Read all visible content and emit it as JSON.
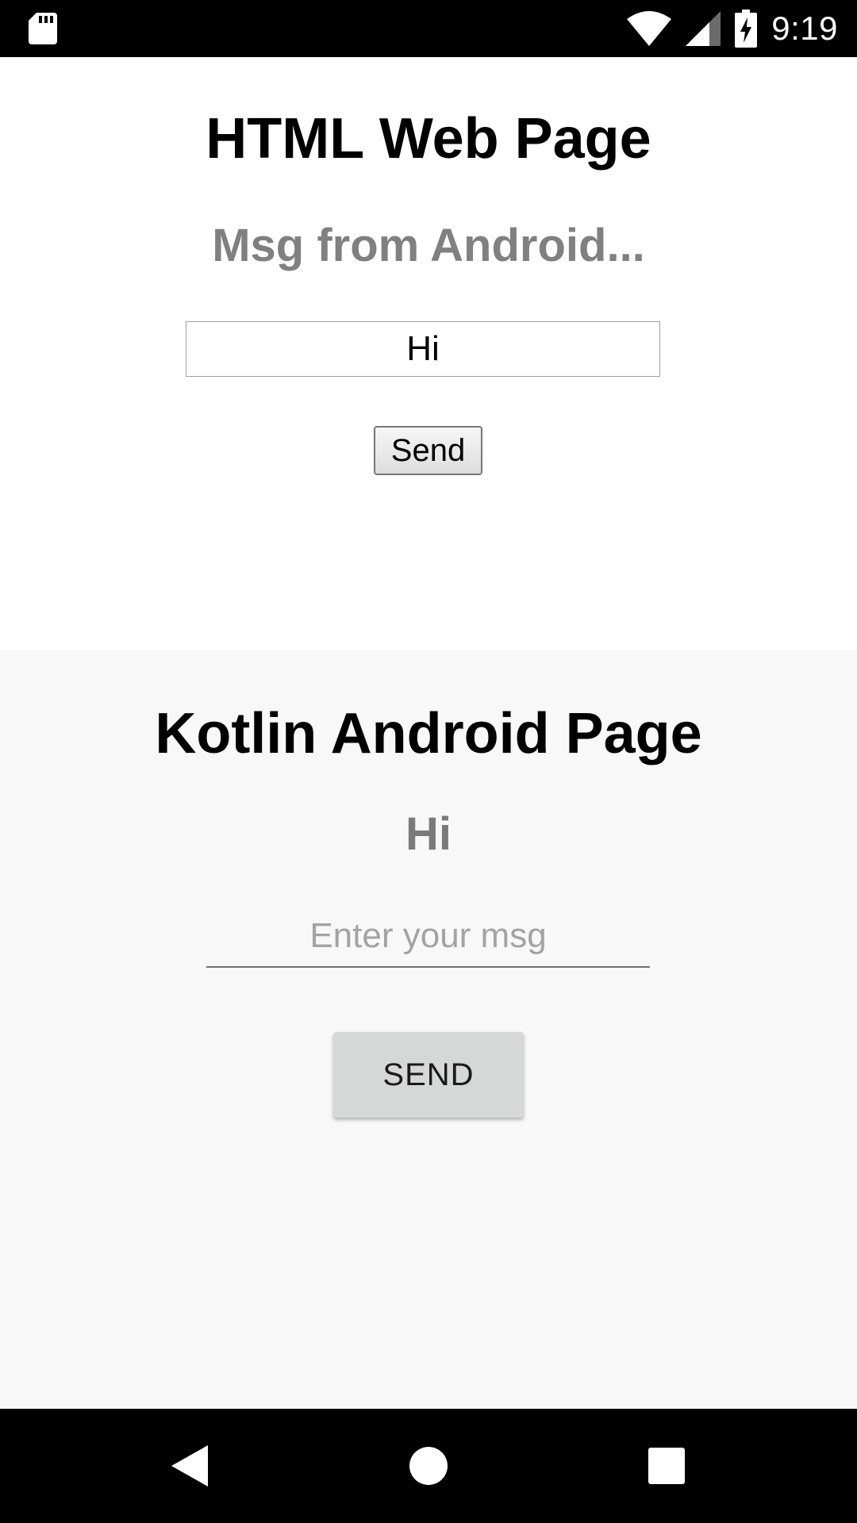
{
  "status_bar": {
    "time": "9:19",
    "icons": [
      "sd-card-icon",
      "wifi-icon",
      "cellular-signal-icon",
      "battery-charging-icon"
    ]
  },
  "web_page": {
    "title": "HTML Web Page",
    "message": "Msg from Android...",
    "input_value": "Hi",
    "send_label": "Send"
  },
  "android_page": {
    "title": "Kotlin Android Page",
    "message": "Hi",
    "input_placeholder": "Enter your msg",
    "send_label": "SEND"
  },
  "nav_bar": {
    "icons": [
      "back-icon",
      "home-icon",
      "recents-icon"
    ]
  },
  "colors": {
    "web_background": "#ffffff",
    "android_background": "#f8f8f8",
    "message_gray": "#808080",
    "bars": "#000000"
  }
}
